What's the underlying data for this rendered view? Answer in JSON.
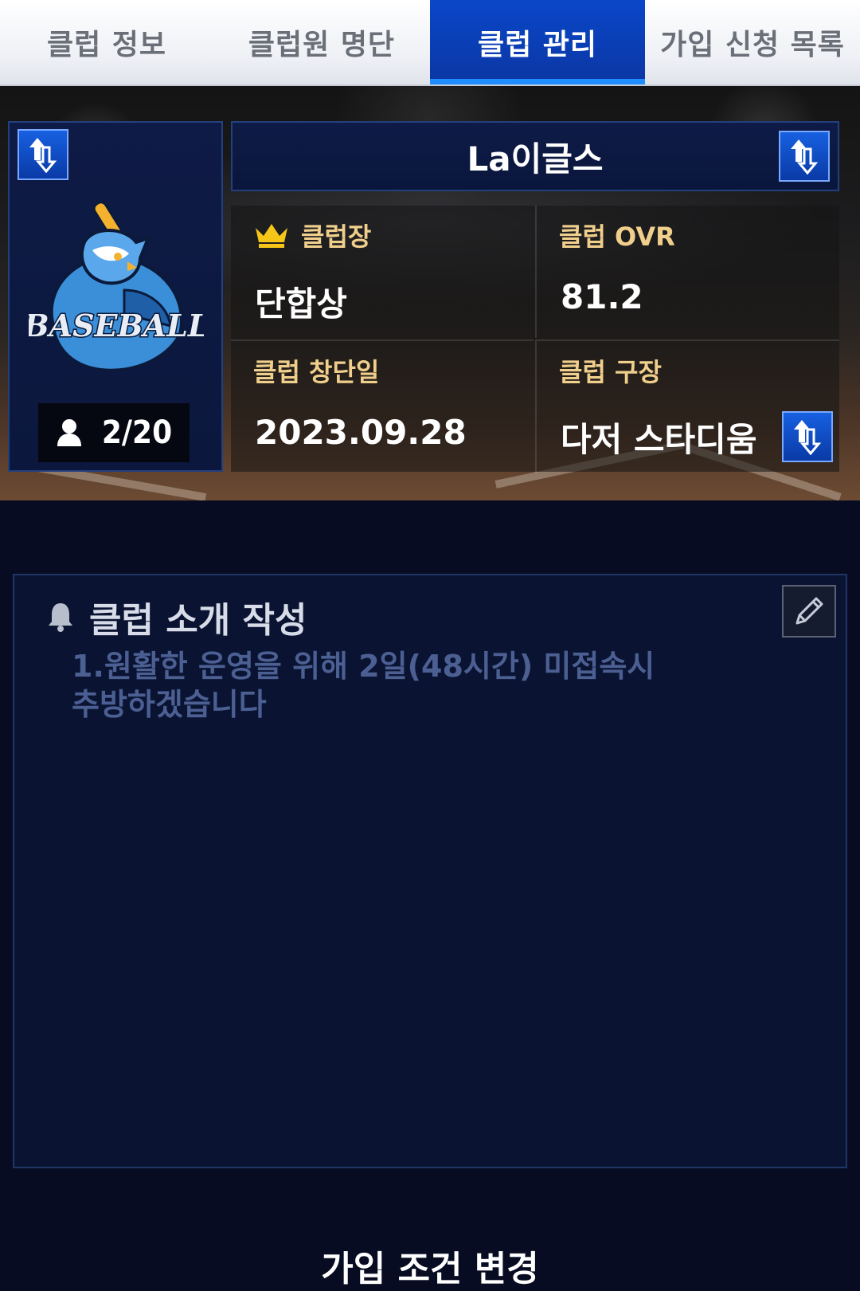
{
  "tabs": [
    {
      "label": "클럽 정보",
      "active": false
    },
    {
      "label": "클럽원 명단",
      "active": false
    },
    {
      "label": "클럽 관리",
      "active": true
    },
    {
      "label": "가입 신청 목록",
      "active": false
    }
  ],
  "club": {
    "name": "La이글스",
    "logo_text": "BASEBALL",
    "members": "2/20"
  },
  "info": {
    "leader_label": "클럽장",
    "leader_value": "단합상",
    "ovr_label": "클럽 OVR",
    "ovr_value": "81.2",
    "founded_label": "클럽 창단일",
    "founded_value": "2023.09.28",
    "stadium_label": "클럽 구장",
    "stadium_value": "다저 스타디움"
  },
  "intro": {
    "title": "클럽 소개 작성",
    "body": "1.원활한 운영을 위해 2일(48시간) 미접속시\n추방하겠습니다"
  },
  "footer": {
    "label": "가입 조건 변경"
  },
  "icons": {
    "swap": "swap-arrows-icon",
    "member": "person-icon",
    "leader": "crown-icon",
    "notice": "bell-icon",
    "edit": "pencil-icon"
  },
  "colors": {
    "tab_active": "#0b3fb8",
    "label_gold": "#f0cf8c",
    "panel_bg": "#0a1432",
    "button_blue": "#1760e0"
  }
}
